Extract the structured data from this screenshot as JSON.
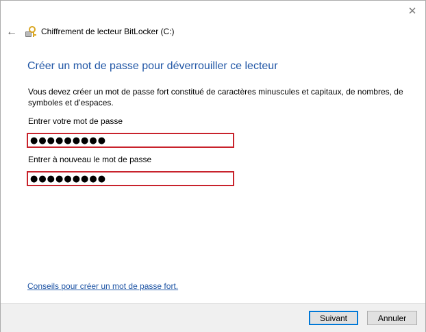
{
  "window": {
    "title": "Chiffrement de lecteur BitLocker (C:)",
    "close_glyph": "✕",
    "back_glyph": "←"
  },
  "main": {
    "heading": "Créer un mot de passe pour déverrouiller ce lecteur",
    "description": "Vous devez créer un mot de passe fort constitué de caractères minuscules et capitaux, de nombres, de symboles et d’espaces.",
    "password_label": "Entrer votre mot de passe",
    "password_value": "●●●●●●●●●",
    "confirm_label": "Entrer à nouveau le mot de passe",
    "confirm_value": "●●●●●●●●●",
    "tips_link": "Conseils pour créer un mot de passe fort."
  },
  "footer": {
    "next_label": "Suivant",
    "cancel_label": "Annuler"
  },
  "colors": {
    "heading": "#1f55a5",
    "field_highlight": "#c8232c",
    "primary_button_border": "#0078d7"
  }
}
